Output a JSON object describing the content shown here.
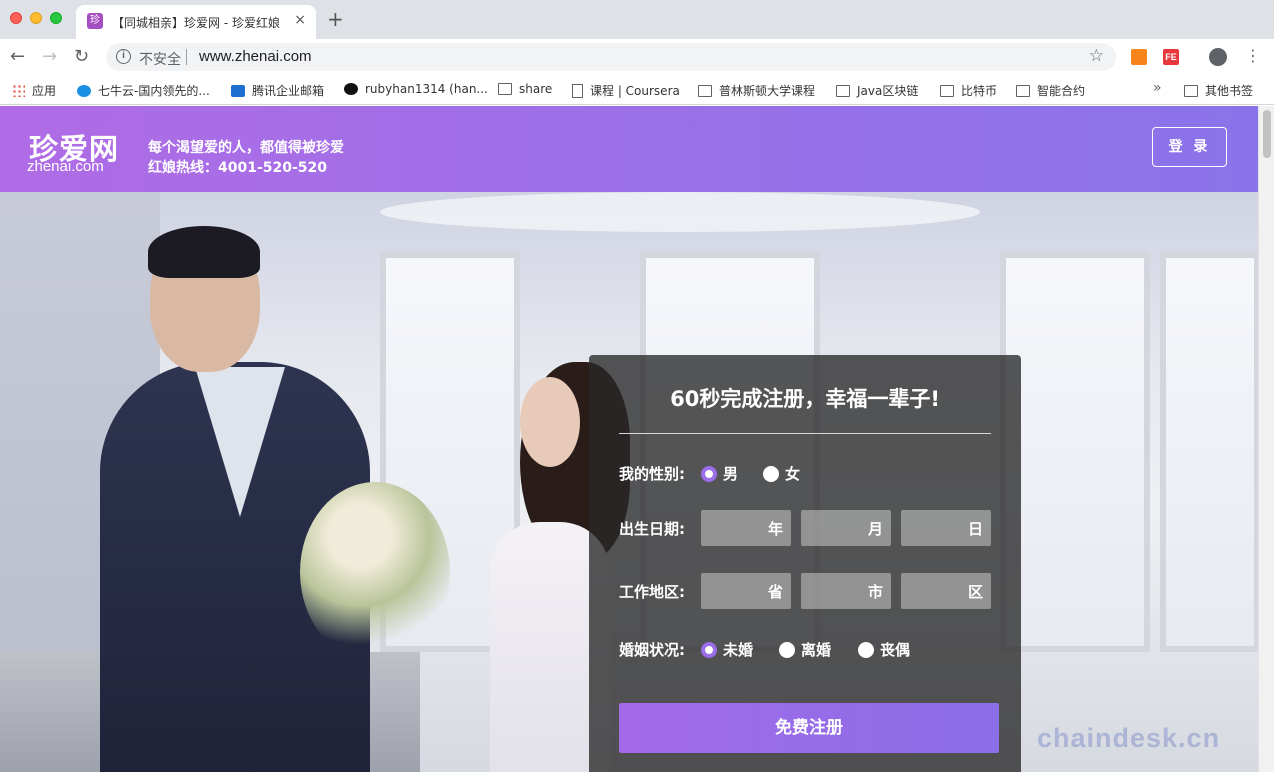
{
  "browser": {
    "tab": {
      "favicon": "珍",
      "title": "【同城相亲】珍爱网 - 珍爱红娘",
      "close": "×"
    },
    "new_tab": "+",
    "nav": {
      "back": "←",
      "forward": "→",
      "reload": "↻"
    },
    "omnibox": {
      "security_label": "不安全",
      "info_glyph": "i",
      "url": "www.zhenai.com",
      "star": "☆"
    },
    "extensions": [
      {
        "name": "metamask-icon",
        "glyph": "🦊"
      },
      {
        "name": "fe-helper-icon",
        "glyph": "FE"
      }
    ],
    "menu": "⋮",
    "bookmarks": [
      {
        "label": "应用",
        "icon": "apps-grid-icon"
      },
      {
        "label": "七牛云-国内领先的...",
        "icon": "qiniu-icon"
      },
      {
        "label": "腾讯企业邮箱",
        "icon": "tencent-mail-icon"
      },
      {
        "label": "rubyhan1314 (han...",
        "icon": "github-icon"
      },
      {
        "label": "share",
        "icon": "folder-icon"
      },
      {
        "label": "课程 | Coursera",
        "icon": "page-icon"
      },
      {
        "label": "普林斯顿大学课程",
        "icon": "folder-icon"
      },
      {
        "label": "Java区块链",
        "icon": "folder-icon"
      },
      {
        "label": "比特币",
        "icon": "folder-icon"
      },
      {
        "label": "智能合约",
        "icon": "folder-icon"
      }
    ],
    "bookmarks_more": "»",
    "other_bookmarks": "其他书签"
  },
  "site": {
    "logo_cn": "珍爱网",
    "logo_en": "zhenai.com",
    "slogan": "每个渴望爱的人，都值得被珍爱",
    "hotline": "红娘热线：4001-520-520",
    "login": "登 录"
  },
  "register": {
    "title": "60秒完成注册，幸福一辈子!",
    "gender": {
      "label": "我的性别:",
      "options": [
        "男",
        "女"
      ],
      "selected": "男"
    },
    "birth": {
      "label": "出生日期:",
      "fields": [
        "年",
        "月",
        "日"
      ]
    },
    "region": {
      "label": "工作地区:",
      "fields": [
        "省",
        "市",
        "区"
      ]
    },
    "marital": {
      "label": "婚姻状况:",
      "options": [
        "未婚",
        "离婚",
        "丧偶"
      ],
      "selected": "未婚"
    },
    "submit": "免费注册"
  },
  "watermark": "chaindesk.cn",
  "colors": {
    "brand_purple": "#9b6fe8",
    "radio_checked": "#9a6ee8"
  }
}
